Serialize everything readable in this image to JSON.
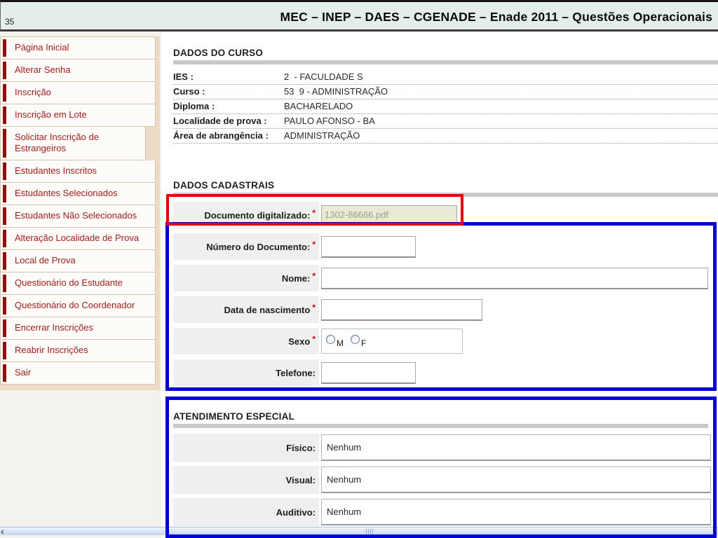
{
  "header": {
    "page_number": "35",
    "title": "MEC – INEP – DAES – CGENADE – Enade 2011 – Questões Operacionais"
  },
  "sidebar": {
    "items": [
      {
        "label": "Página Inicial"
      },
      {
        "label": "Alterar Senha"
      },
      {
        "label": "Inscrição"
      },
      {
        "label": "Inscrição em Lote"
      },
      {
        "label": "Solicitar Inscrição de Estrangeiros"
      },
      {
        "label": "Estudantes Inscritos"
      },
      {
        "label": "Estudantes Selecionados"
      },
      {
        "label": "Estudantes Não Selecionados"
      },
      {
        "label": "Alteração Localidade de Prova"
      },
      {
        "label": "Local de Prova"
      },
      {
        "label": "Questionário do Estudante"
      },
      {
        "label": "Questionário do Coordenador"
      },
      {
        "label": "Encerrar Inscrições"
      },
      {
        "label": "Reabrir Inscrições"
      },
      {
        "label": "Sair"
      }
    ]
  },
  "course": {
    "section_title": "DADOS DO CURSO",
    "rows": [
      {
        "label": "IES :",
        "value": "2  - FACULDADE S"
      },
      {
        "label": "Curso :",
        "value": "53  9 - ADMINISTRAÇÃO"
      },
      {
        "label": "Diploma :",
        "value": "BACHARELADO"
      },
      {
        "label": "Localidade de prova :",
        "value": "PAULO AFONSO - BA"
      },
      {
        "label": "Área de abrangência :",
        "value": "ADMINISTRAÇÃO"
      }
    ]
  },
  "registration": {
    "section_title": "DADOS CADASTRAIS",
    "fields": {
      "documento": {
        "label": "Documento digitalizado:",
        "required": "*",
        "value": "1302-86666.pdf"
      },
      "numero": {
        "label": "Número do Documento:",
        "required": "*",
        "value": ""
      },
      "nome": {
        "label": "Nome:",
        "required": "*",
        "value": ""
      },
      "nascimento": {
        "label": "Data de nascimento",
        "required": "*",
        "value": ""
      },
      "sexo": {
        "label": "Sexo",
        "required": "*",
        "options": [
          "M",
          "F"
        ]
      },
      "telefone": {
        "label": "Telefone:",
        "value": ""
      }
    }
  },
  "special_care": {
    "section_title": "ATENDIMENTO ESPECIAL",
    "rows": [
      {
        "label": "Físico:",
        "value": "Nenhum"
      },
      {
        "label": "Visual:",
        "value": "Nenhum"
      },
      {
        "label": "Auditivo:",
        "value": "Nenhum"
      }
    ]
  },
  "icons": {
    "scroll_left_arrow": "‹"
  },
  "colors": {
    "annotation_red": "#e60000",
    "annotation_blue": "#0101d6",
    "header_bg": "#e3ede9",
    "sidebar_link": "#9e1b1b",
    "disabled_field_bg": "#ece9d8"
  }
}
